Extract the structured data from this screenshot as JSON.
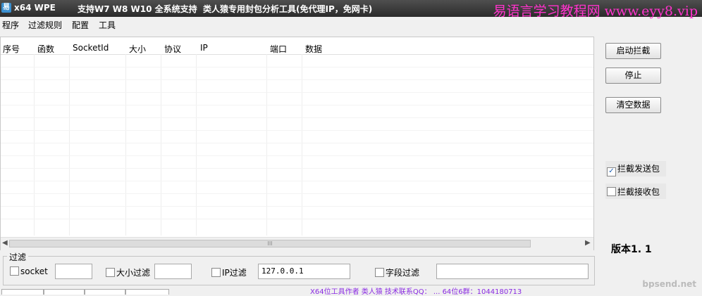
{
  "window": {
    "title": "x64 WPE",
    "subtitle1": "支持W7 W8 W10 全系统支持",
    "subtitle2": "类人猿专用封包分析工具(免代理IP，免网卡)",
    "watermark": "易语言学习教程网 www.eyy8.vip",
    "icon": "易"
  },
  "menu": [
    "程序",
    "过滤规则",
    "配置",
    "工具"
  ],
  "table": {
    "columns": [
      "序号",
      "函数",
      "SocketId",
      "大小",
      "协议",
      "IP",
      "端口",
      "数据"
    ],
    "rows": []
  },
  "buttons": {
    "start_intercept": "启动拦截",
    "stop": "停止",
    "clear_data": "清空数据"
  },
  "options": {
    "intercept_send": {
      "label": "拦截发送包",
      "checked": true
    },
    "intercept_recv": {
      "label": "拦截接收包",
      "checked": false
    }
  },
  "version": "版本1. 1",
  "filter": {
    "group_label": "过滤",
    "socket_label": "socket",
    "size_label": "大小过滤",
    "ip_label": "IP过滤",
    "ip_value": "127.0.0.1",
    "field_label": "字段过滤"
  },
  "footer": {
    "site": "bpsend.net",
    "status": "X64位工具作者 类人猿  技术联系QQ：  ...  64位6群：1044180713"
  },
  "scrollbar_grip": "III"
}
